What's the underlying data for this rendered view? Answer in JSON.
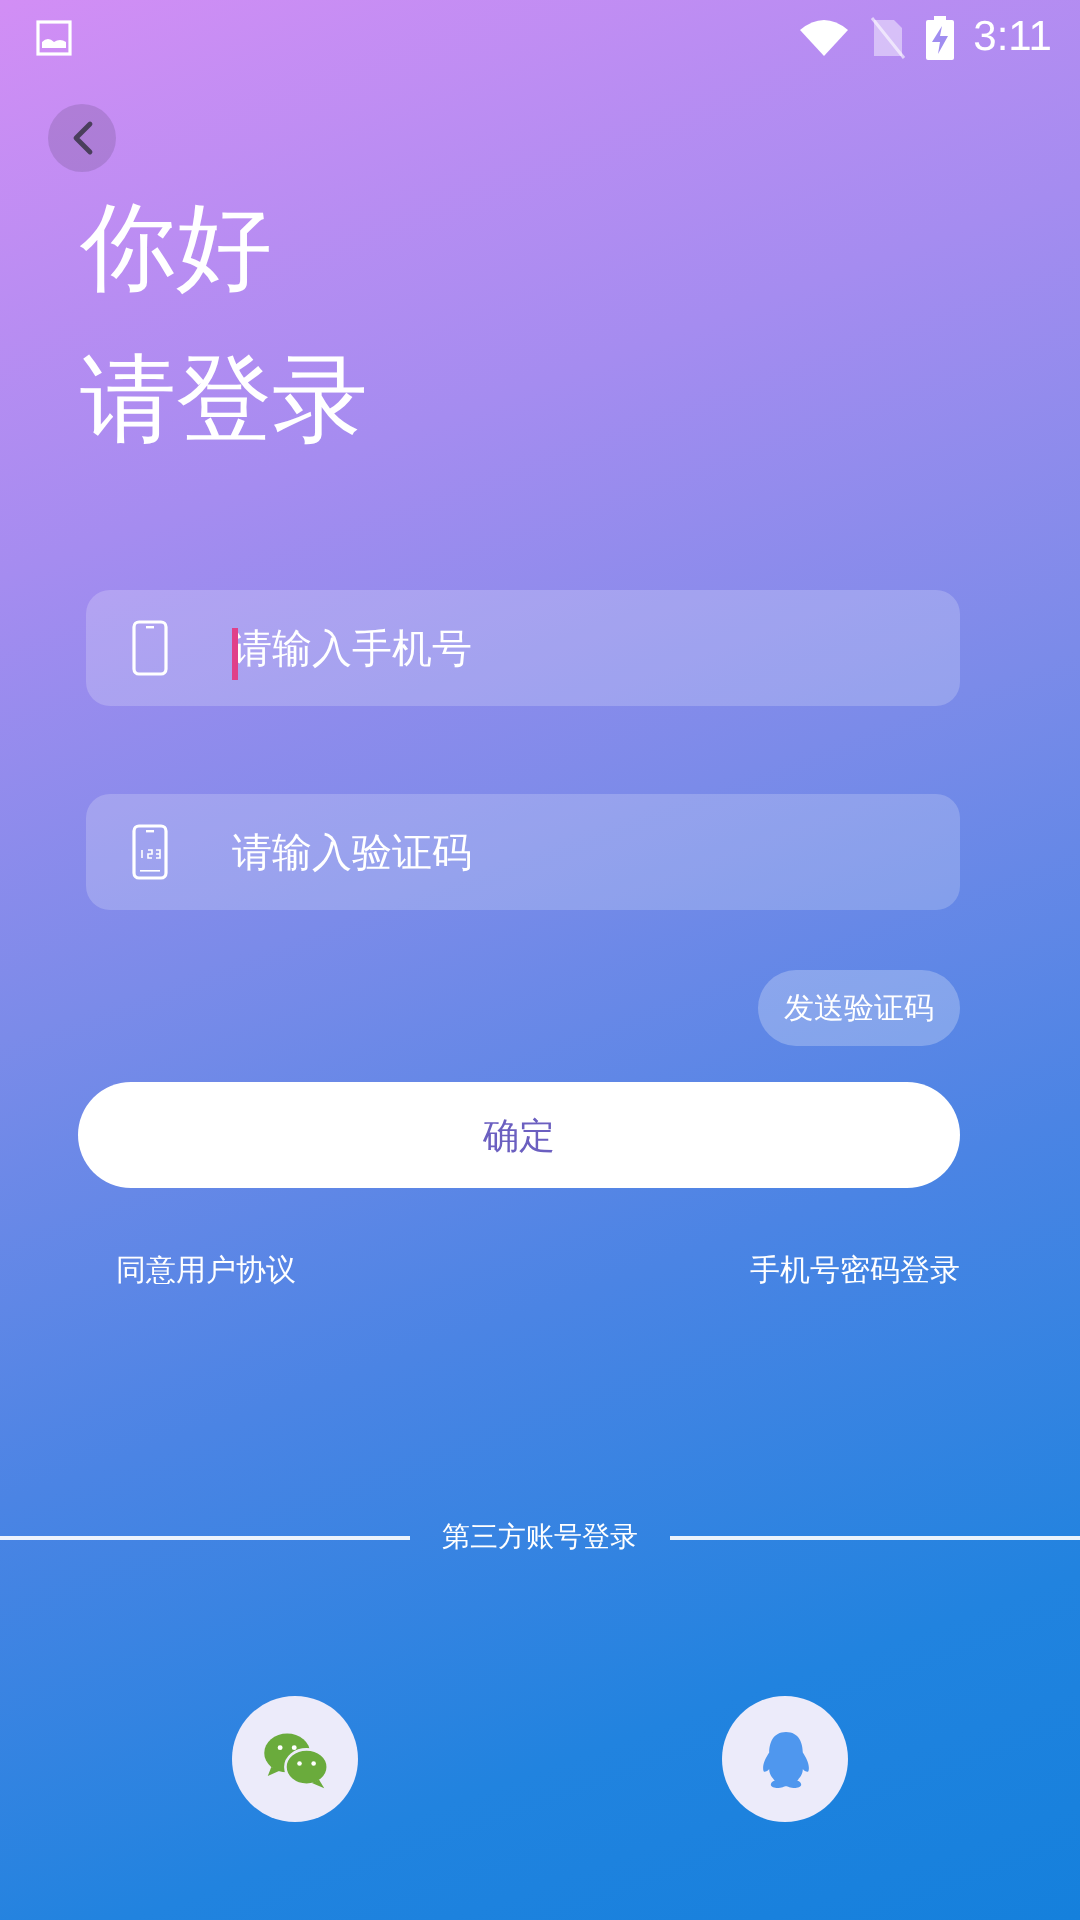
{
  "status_bar": {
    "time": "3:11"
  },
  "greeting": [
    "你好",
    "请登录"
  ],
  "fields": [
    {
      "kind": "phone",
      "placeholder": "请输入手机号",
      "focused": true
    },
    {
      "kind": "code",
      "placeholder": "请输入验证码",
      "focused": false
    }
  ],
  "send_code_button": "发送验证码",
  "confirm_button": "确定",
  "links": [
    "同意用户协议",
    "手机号密码登录"
  ],
  "third_party": {
    "label": "第三方账号登录",
    "buttons": [
      {
        "kind": "wechat"
      },
      {
        "kind": "qq"
      }
    ]
  }
}
